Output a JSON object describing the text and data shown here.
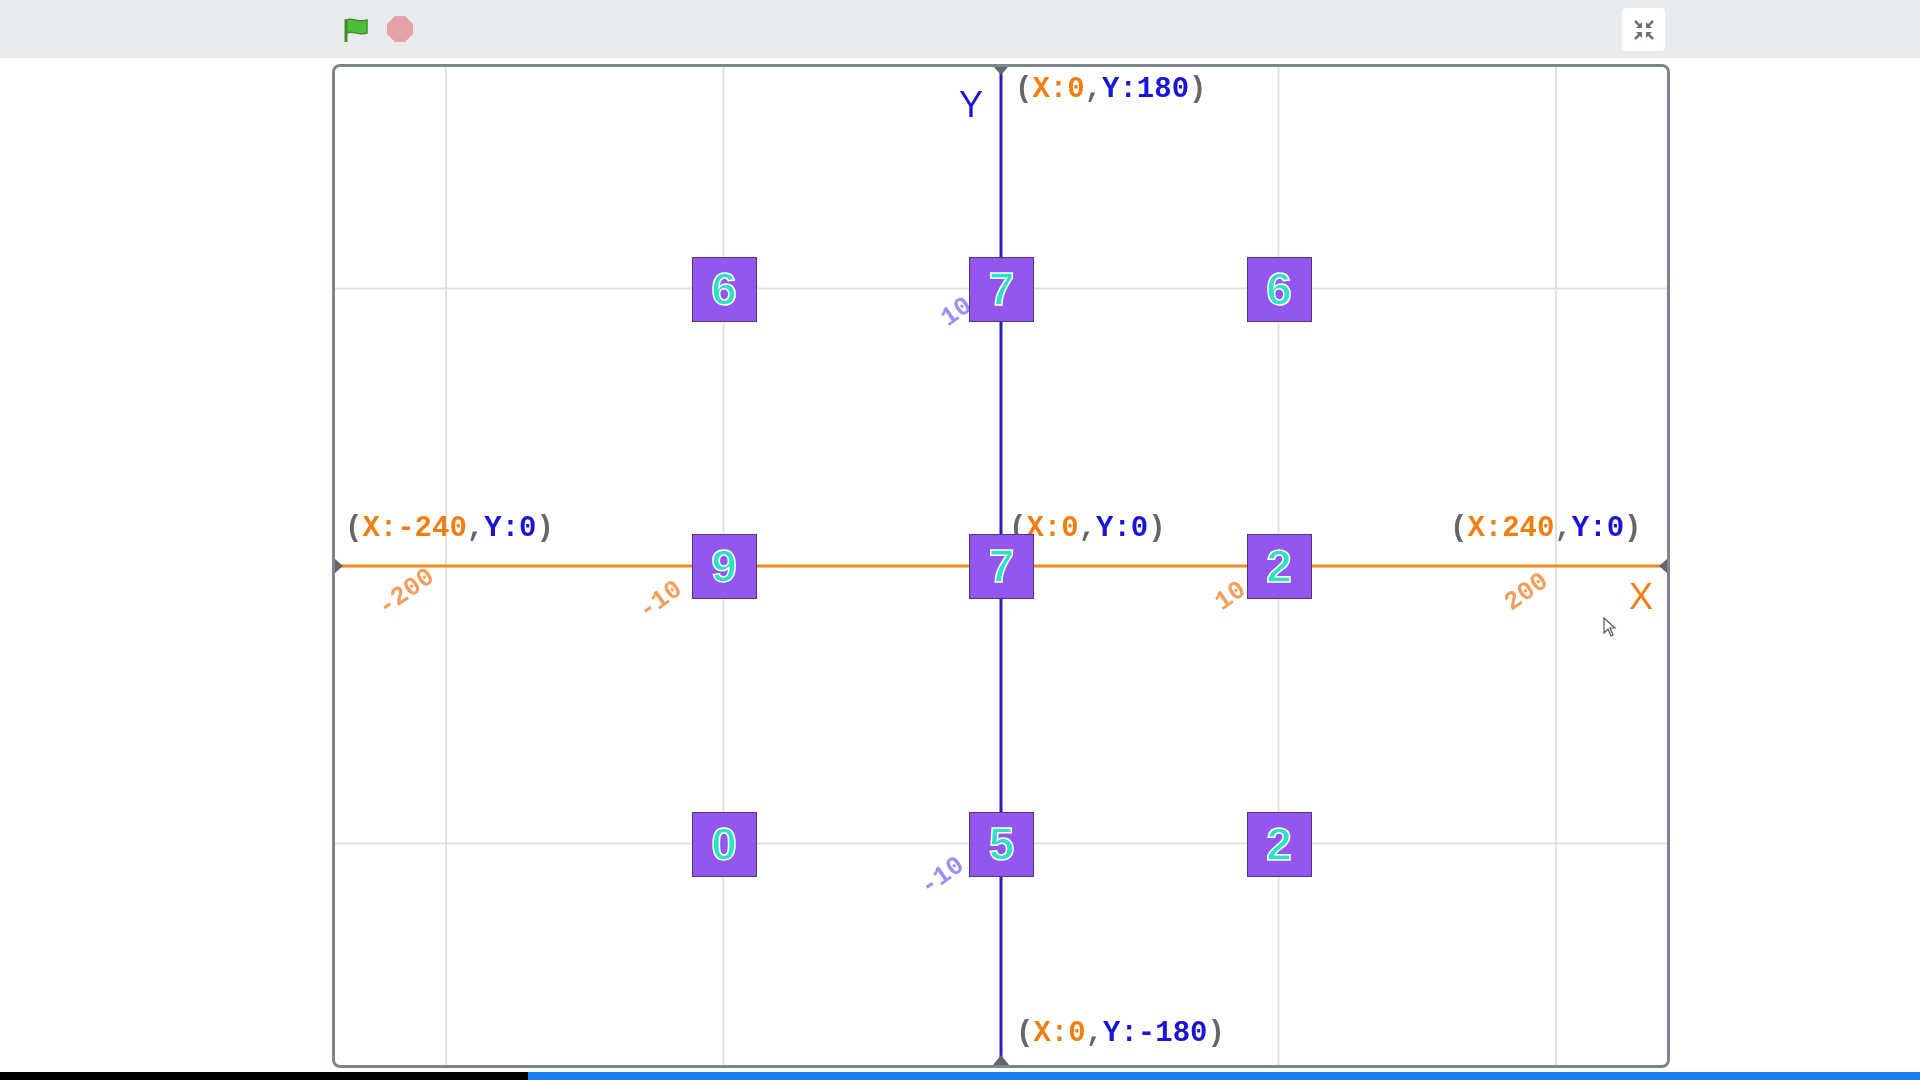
{
  "axes": {
    "y_letter": "Y",
    "x_letter": "X"
  },
  "coordinate_labels": [
    {
      "parts": [
        {
          "text": "(",
          "kind": "punct"
        },
        {
          "text": "X:0",
          "kind": "x"
        },
        {
          "text": ",",
          "kind": "punct"
        },
        {
          "text": "Y:180",
          "kind": "y"
        },
        {
          "text": ")",
          "kind": "punct"
        }
      ]
    },
    {
      "parts": [
        {
          "text": "(",
          "kind": "punct"
        },
        {
          "text": "X:-240",
          "kind": "x"
        },
        {
          "text": ",",
          "kind": "punct"
        },
        {
          "text": "Y:0",
          "kind": "y"
        },
        {
          "text": ")",
          "kind": "punct"
        }
      ]
    },
    {
      "parts": [
        {
          "text": "(",
          "kind": "punct"
        },
        {
          "text": "X:0",
          "kind": "x"
        },
        {
          "text": ",",
          "kind": "punct"
        },
        {
          "text": "Y:0",
          "kind": "y"
        },
        {
          "text": ")",
          "kind": "punct"
        }
      ]
    },
    {
      "parts": [
        {
          "text": "(",
          "kind": "punct"
        },
        {
          "text": "X:240",
          "kind": "x"
        },
        {
          "text": ",",
          "kind": "punct"
        },
        {
          "text": "Y:0",
          "kind": "y"
        },
        {
          "text": ")",
          "kind": "punct"
        }
      ]
    },
    {
      "parts": [
        {
          "text": "(",
          "kind": "punct"
        },
        {
          "text": "X:0",
          "kind": "x"
        },
        {
          "text": ",",
          "kind": "punct"
        },
        {
          "text": "Y:-180",
          "kind": "y"
        },
        {
          "text": ")",
          "kind": "punct"
        }
      ]
    }
  ],
  "tick_labels": [
    {
      "text": "-200",
      "kind": "horizontal"
    },
    {
      "text": "-10",
      "kind": "horizontal"
    },
    {
      "text": "10",
      "kind": "horizontal"
    },
    {
      "text": "200",
      "kind": "horizontal"
    },
    {
      "text": "10",
      "kind": "vertical"
    },
    {
      "text": "-10",
      "kind": "vertical"
    }
  ],
  "tiles": [
    [
      "6",
      "7",
      "6"
    ],
    [
      "9",
      "7",
      "2"
    ],
    [
      "0",
      "5",
      "2"
    ]
  ],
  "progress": {
    "level": 0.275
  }
}
